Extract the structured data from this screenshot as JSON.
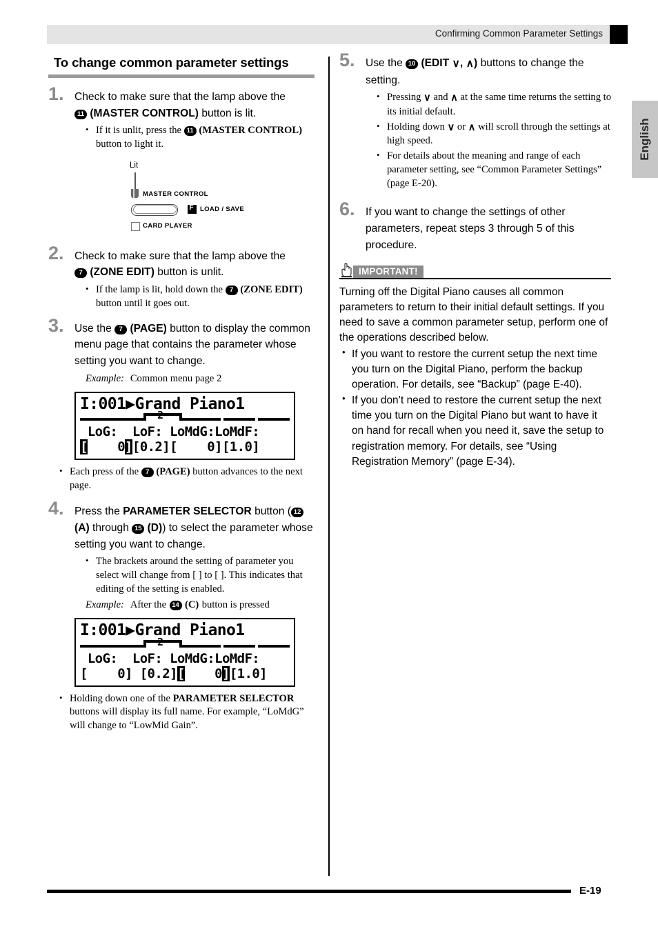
{
  "header": {
    "title": "Confirming Common Parameter Settings",
    "lang_tab": "English"
  },
  "footer": {
    "page": "E-19"
  },
  "left_column": {
    "section_heading": "To change common parameter settings",
    "step1": {
      "number": "1.",
      "line1": "Check to make sure that the lamp above the",
      "badge": "11",
      "line2_bold": "(MASTER CONTROL)",
      "line2_rest": "button is lit.",
      "bullet_pre": "If it is unlit, press the",
      "bullet_badge": "11",
      "bullet_bold": "(MASTER CONTROL)",
      "bullet_post": "button to light it."
    },
    "illustration": {
      "lit_label": "Lit",
      "master_control_label": "MASTER CONTROL",
      "load_save_label": "LOAD / SAVE",
      "load_save_icon": "F",
      "card_player_label": "CARD PLAYER"
    },
    "step2": {
      "number": "2.",
      "line1": "Check to make sure that the lamp above the",
      "badge": "7",
      "line2_bold": "(ZONE EDIT)",
      "line2_rest": "button is unlit.",
      "bullet_pre": "If the lamp is lit, hold down the",
      "bullet_badge": "7",
      "bullet_bold": "(ZONE EDIT)",
      "bullet_post": "button until it goes out."
    },
    "step3": {
      "number": "3.",
      "pre": "Use the",
      "badge": "7",
      "bold": "(PAGE)",
      "post": "button to display the common menu page that contains the parameter whose setting you want to change.",
      "example_label": "Example:",
      "example_value": "Common menu page 2",
      "bullet_pre": "Each press of the",
      "bullet_badge": "7",
      "bullet_bold": "(PAGE)",
      "bullet_post": "button advances to the next page."
    },
    "lcd1": {
      "row1": "I:001▶Grand Piano1",
      "page_number": "2",
      "row3": " LoG:  LoF: LoMdG:LoMdF:",
      "row4_cursor": "[",
      "row4_a": "    0",
      "row4_cursor2": "]",
      "row4_rest": "[0.2][    0][1.0]"
    },
    "step4": {
      "number": "4.",
      "pre": "Press the",
      "bold1": "PARAMETER SELECTOR",
      "mid": "button (",
      "badge1": "12",
      "bold2": "(A)",
      "through": "through",
      "badge2": "15",
      "bold3": "(D)",
      "post": ") to select the parameter whose setting you want to change.",
      "bullet1": "The brackets around the setting of parameter you select will change from [    ] to [   ]. This indicates that editing of the setting is enabled.",
      "example_label": "Example:",
      "example_pre": "After the",
      "example_badge": "14",
      "example_bold": "(C)",
      "example_post": "button is pressed"
    },
    "lcd2": {
      "row1": "I:001▶Grand Piano1",
      "page_number": "2",
      "row3": " LoG:  LoF: LoMdG:LoMdF:",
      "row4_a": "[    0] [0.2]",
      "row4_cursor": "[",
      "row4_b": "    0",
      "row4_cursor2": "]",
      "row4_rest": "[1.0]"
    },
    "step4_note": {
      "pre": "Holding down one of the",
      "bold": "PARAMETER SELECTOR",
      "post": "buttons will display its full name. For example, “LoMdG” will change to “LowMid Gain”."
    }
  },
  "right_column": {
    "step5": {
      "number": "5.",
      "pre": "Use the",
      "badge": "10",
      "bold_open": "(EDIT",
      "chev_down": "∨",
      "chev_up": "∧",
      "bold_close": ")",
      "post": "buttons to change the setting.",
      "bullets": [
        {
          "pre": "Pressing",
          "mid": "and",
          "post": "at the same time returns the setting to its initial default."
        },
        {
          "pre": "Holding down",
          "mid": "or",
          "post": "will scroll through the settings at high speed."
        }
      ],
      "bullet3": "For details about the meaning and range of each parameter setting, see “Common Parameter Settings” (page E-20)."
    },
    "step6": {
      "number": "6.",
      "text": "If you want to change the settings of other parameters, repeat steps 3 through 5 of this procedure."
    },
    "important": {
      "tag": "IMPORTANT!",
      "body": "Turning off the Digital Piano causes all common parameters to return to their initial default settings. If you need to save a common parameter setup, perform one of the operations described below.",
      "bullets": [
        "If you want to restore the current setup the next time you turn on the Digital Piano, perform the backup operation. For details, see “Backup” (page E-40).",
        "If you don’t need to restore the current setup the next time you turn on the Digital Piano but want to have it on hand for recall when you need it, save the setup to registration memory. For details, see “Using Registration Memory” (page E-34)."
      ]
    }
  }
}
